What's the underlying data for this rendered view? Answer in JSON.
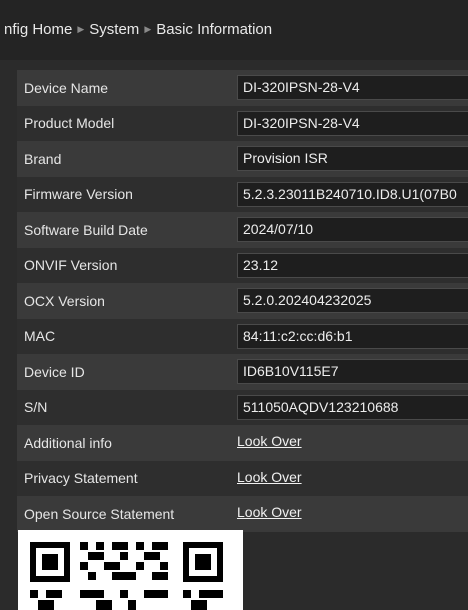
{
  "breadcrumb": [
    "nfig Home",
    "System",
    "Basic Information"
  ],
  "fields": [
    {
      "label": "Device Name",
      "value": "DI-320IPSN-28-V4"
    },
    {
      "label": "Product Model",
      "value": "DI-320IPSN-28-V4"
    },
    {
      "label": "Brand",
      "value": "Provision ISR"
    },
    {
      "label": "Firmware Version",
      "value": "5.2.3.23011B240710.ID8.U1(07B0"
    },
    {
      "label": "Software Build Date",
      "value": "2024/07/10"
    },
    {
      "label": "ONVIF Version",
      "value": "23.12"
    },
    {
      "label": "OCX Version",
      "value": "5.2.0.202404232025"
    },
    {
      "label": "MAC",
      "value": "84:11:c2:cc:d6:b1"
    },
    {
      "label": "Device ID",
      "value": "ID6B10V115E7"
    },
    {
      "label": "S/N",
      "value": "511050AQDV123210688"
    }
  ],
  "links": [
    {
      "label": "Additional info",
      "link": "Look Over"
    },
    {
      "label": "Privacy Statement",
      "link": "Look Over"
    },
    {
      "label": "Open Source Statement",
      "link": "Look Over"
    }
  ]
}
